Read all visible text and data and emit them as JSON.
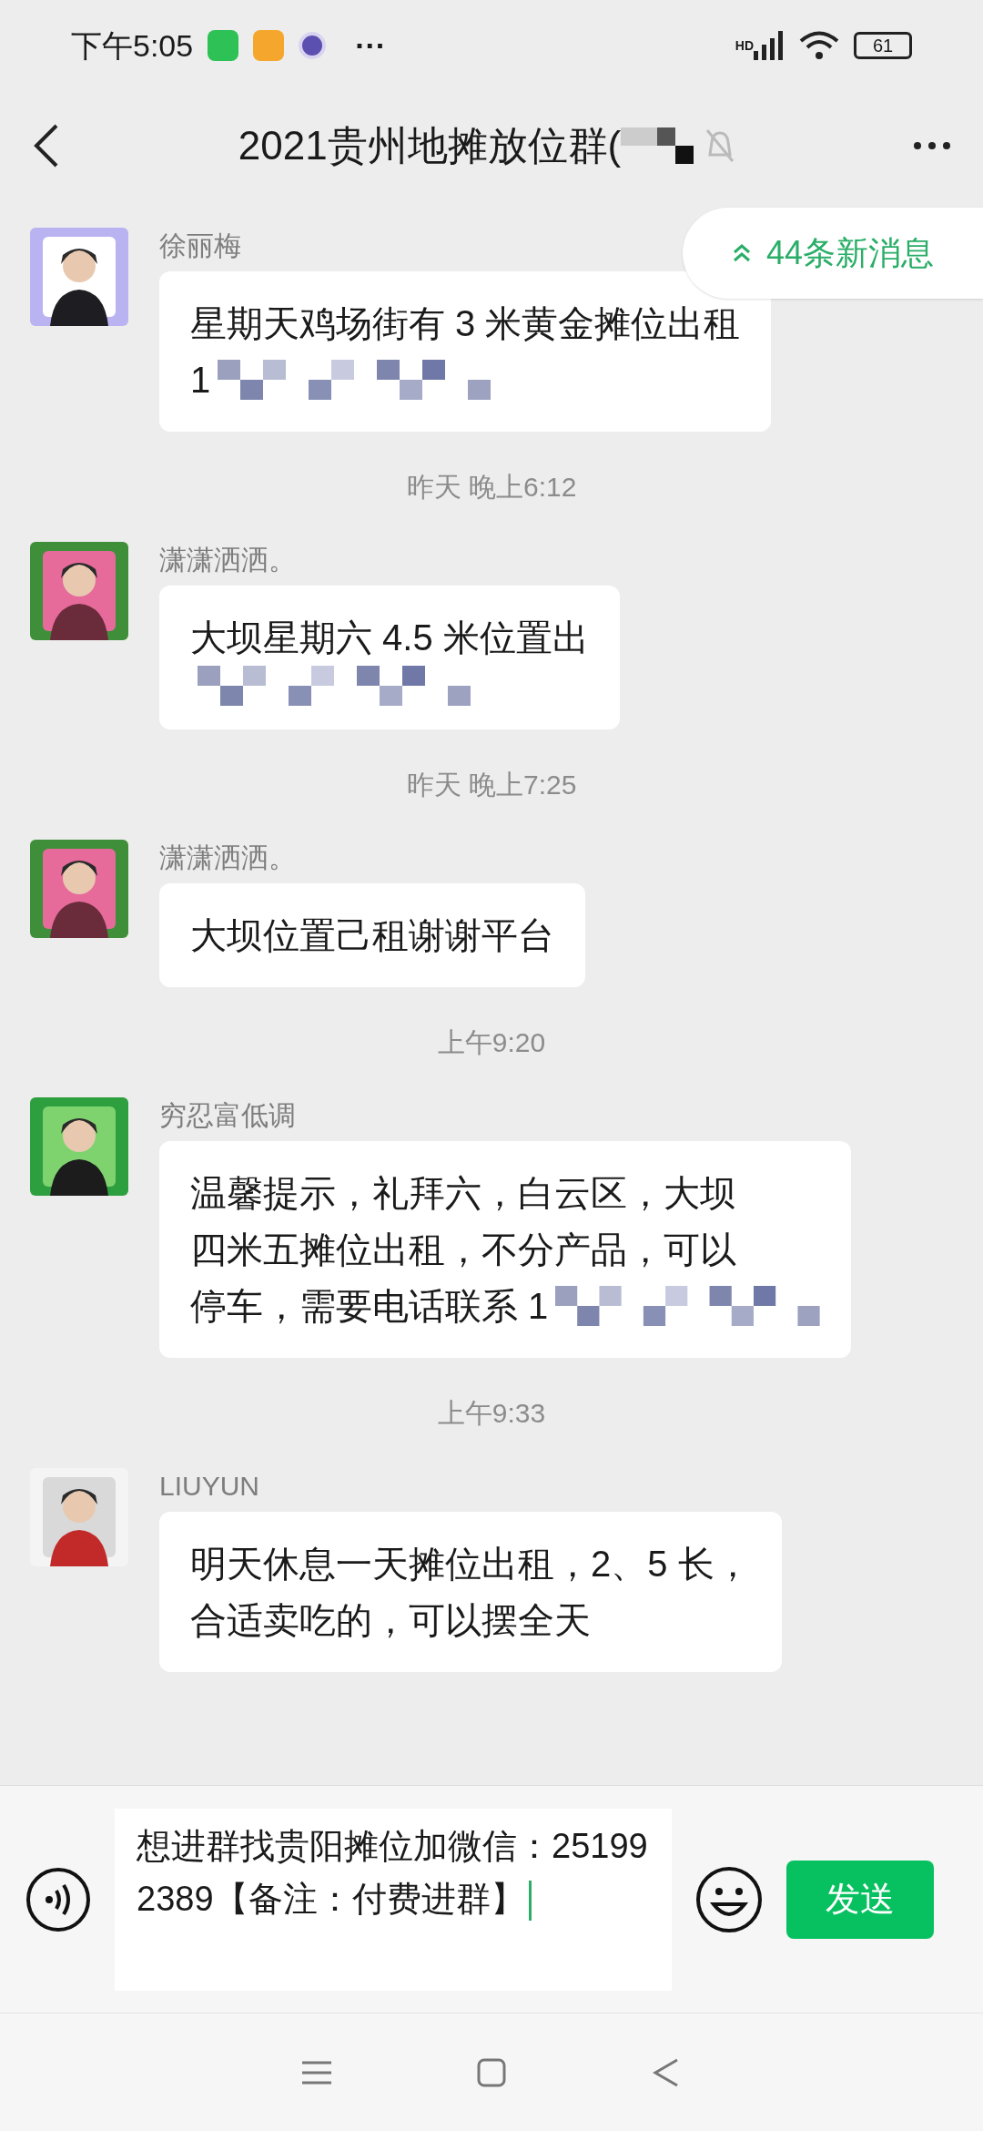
{
  "status_bar": {
    "time": "下午5:05",
    "more": "···",
    "network": "HD",
    "battery": "61"
  },
  "header": {
    "title_parts": [
      {
        "kind": "text",
        "text": "2021贵州地摊放位群("
      },
      {
        "kind": "blur"
      }
    ],
    "muted": true
  },
  "new_messages_pill": {
    "label": "44条新消息"
  },
  "messages": [
    {
      "kind": "message",
      "sender": "徐丽梅",
      "lines": [
        {
          "parts": [
            {
              "kind": "text",
              "text": "星期天鸡场街有 3 米黄金摊位出租"
            }
          ]
        },
        {
          "parts": [
            {
              "kind": "text",
              "text": "1"
            },
            {
              "kind": "blur"
            }
          ]
        }
      ]
    },
    {
      "kind": "time",
      "text": "昨天 晚上6:12"
    },
    {
      "kind": "message",
      "sender": "潇潇洒洒。",
      "lines": [
        {
          "parts": [
            {
              "kind": "text",
              "text": "大坝星期六 4.5 米位置出"
            }
          ]
        },
        {
          "parts": [
            {
              "kind": "blur"
            }
          ]
        }
      ]
    },
    {
      "kind": "time",
      "text": "昨天 晚上7:25"
    },
    {
      "kind": "message",
      "sender": "潇潇洒洒。",
      "lines": [
        {
          "parts": [
            {
              "kind": "text",
              "text": "大坝位置己租谢谢平台"
            }
          ]
        }
      ]
    },
    {
      "kind": "time",
      "text": "上午9:20"
    },
    {
      "kind": "message",
      "sender": "穷忍富低调",
      "lines": [
        {
          "parts": [
            {
              "kind": "text",
              "text": "温馨提示，礼拜六，白云区，大坝"
            }
          ]
        },
        {
          "parts": [
            {
              "kind": "text",
              "text": "四米五摊位出租，不分产品，可以"
            }
          ]
        },
        {
          "parts": [
            {
              "kind": "text",
              "text": "停车，需要电话联系 1"
            },
            {
              "kind": "blur"
            }
          ]
        }
      ]
    },
    {
      "kind": "time",
      "text": "上午9:33"
    },
    {
      "kind": "message",
      "sender": "LIUYUN",
      "lines": [
        {
          "parts": [
            {
              "kind": "text",
              "text": "明天休息一天摊位出租，2、5 长，"
            }
          ]
        },
        {
          "parts": [
            {
              "kind": "text",
              "text": "合适卖吃的，可以摆全天"
            }
          ]
        }
      ]
    }
  ],
  "input": {
    "value": "想进群找贵阳摊位加微信：251992389【备注：付费进群】",
    "send": "发送"
  }
}
